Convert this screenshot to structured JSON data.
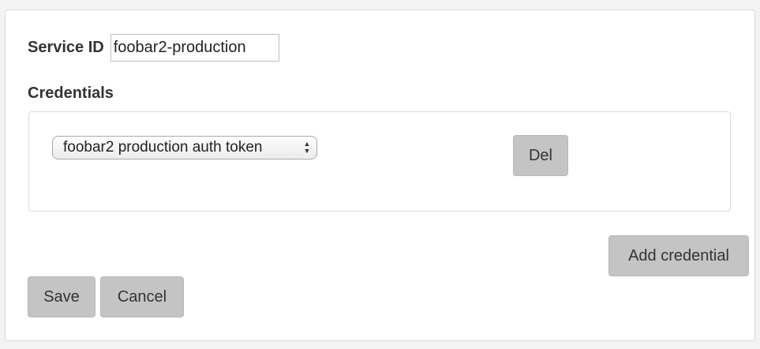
{
  "service": {
    "label": "Service ID",
    "value": "foobar2-production"
  },
  "credentials": {
    "heading": "Credentials",
    "items": [
      {
        "selected": "foobar2 production auth token",
        "delete_label": "Del"
      }
    ],
    "add_label": "Add credential"
  },
  "actions": {
    "save_label": "Save",
    "cancel_label": "Cancel"
  },
  "icons": {
    "select_arrows": "updown-arrows-icon"
  }
}
